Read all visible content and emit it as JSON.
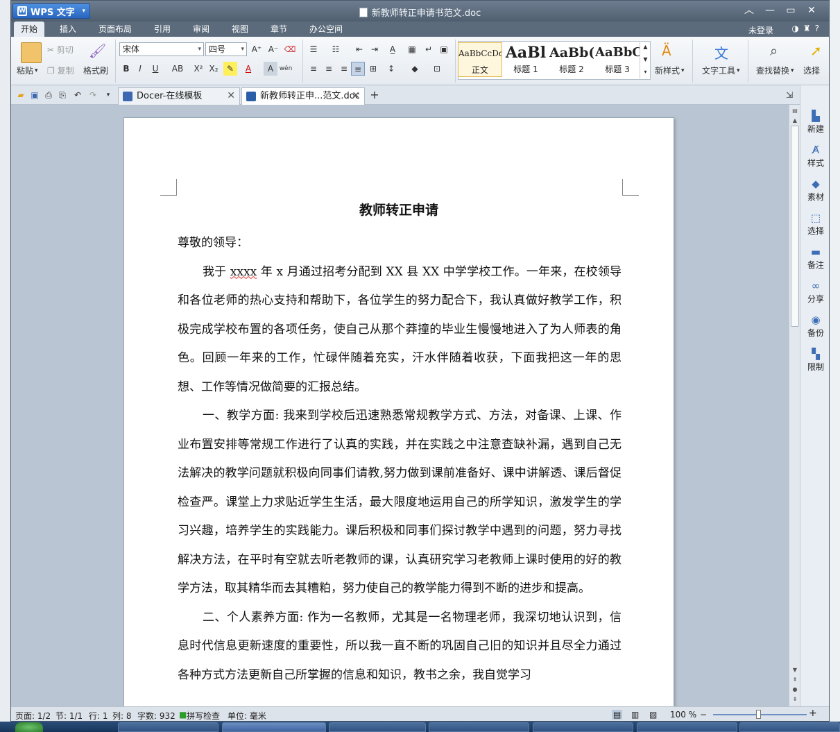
{
  "app": {
    "name": "WPS 文字",
    "doc_title": "新教师转正申请书范文.doc"
  },
  "menu_tabs": [
    "开始",
    "插入",
    "页面布局",
    "引用",
    "审阅",
    "视图",
    "章节",
    "办公空间"
  ],
  "login": "未登录",
  "ribbon": {
    "paste": "粘贴",
    "cut": "剪切",
    "copy": "复制",
    "format_painter": "格式刷",
    "font_name": "宋体",
    "font_size": "四号",
    "styles": [
      {
        "preview": "AaBbCcDd",
        "label": "正文"
      },
      {
        "preview": "AaBl",
        "label": "标题 1"
      },
      {
        "preview": "AaBb(",
        "label": "标题 2"
      },
      {
        "preview": "AaBbC",
        "label": "标题 3"
      }
    ],
    "new_style": "新样式",
    "text_tools": "文字工具",
    "find_replace": "查找替换",
    "select": "选择"
  },
  "doc_tabs": [
    {
      "label": "Docer-在线模板"
    },
    {
      "label": "新教师转正申...范文.doc"
    }
  ],
  "document": {
    "heading": "教师转正申请",
    "salutation": "尊敬的领导：",
    "p1_before": "我于 ",
    "p1_squig": "xxxx",
    "p1_after": " 年 x 月通过招考分配到 XX 县 XX 中学学校工作。一年来，在校领导和各位老师的热心支持和帮助下，各位学生的努力配合下，我认真做好教学工作，积极完成学校布置的各项任务，使自己从那个莽撞的毕业生慢慢地进入了为人师表的角色。回顾一年来的工作，忙碌伴随着充实，汗水伴随着收获，下面我把这一年的思想、工作等情况做简要的汇报总结。",
    "p2": "一、教学方面: 我来到学校后迅速熟悉常规教学方式、方法，对备课、上课、作业布置安排等常规工作进行了认真的实践，并在实践之中注意查缺补漏，遇到自己无法解决的教学问题就积极向同事们请教,努力做到课前准备好、课中讲解透、课后督促检查严。课堂上力求贴近学生生活，最大限度地运用自己的所学知识，激发学生的学习兴趣，培养学生的实践能力。课后积极和同事们探讨教学中遇到的问题，努力寻找解决方法，在平时有空就去听老教师的课，认真研究学习老教师上课时使用的好的教学方法，取其精华而去其糟粕，努力使自己的教学能力得到不断的进步和提高。",
    "p3": "二、个人素养方面: 作为一名教师，尤其是一名物理老师，我深切地认识到，信息时代信息更新速度的重要性，所以我一直不断的巩固自己旧的知识并且尽全力通过各种方式方法更新自己所掌握的信息和知识，教书之余，我自觉学习"
  },
  "side_panel": [
    "新建",
    "样式",
    "素材",
    "选择",
    "备注",
    "分享",
    "备份",
    "限制"
  ],
  "status": {
    "page": "页面: 1/2",
    "section": "节: 1/1",
    "row": "行: 1",
    "col": "列: 8",
    "words": "字数: 932",
    "spell": "拼写检查",
    "unit": "单位: 毫米",
    "zoom": "100 %"
  }
}
